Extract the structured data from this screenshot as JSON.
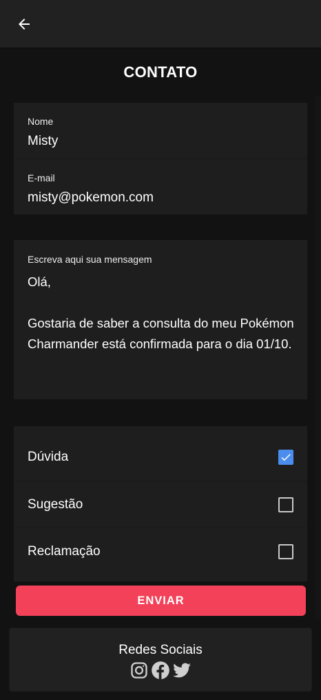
{
  "header": {
    "back_icon": "arrow-left-icon"
  },
  "page": {
    "title": "CONTATO"
  },
  "contact": {
    "name_label": "Nome",
    "name_value": "Misty",
    "email_label": "E-mail",
    "email_value": "misty@pokemon.com"
  },
  "message": {
    "label": "Escreva aqui sua mensagem",
    "value": "Olá,\n\nGostaria de saber a consulta do meu Pokémon Charmander está confirmada para o dia 01/10."
  },
  "options": [
    {
      "label": "Dúvida",
      "checked": true
    },
    {
      "label": "Sugestão",
      "checked": false
    },
    {
      "label": "Reclamação",
      "checked": false
    }
  ],
  "actions": {
    "send_label": "ENVIAR"
  },
  "footer": {
    "title": "Redes Sociais",
    "icons": [
      "instagram-icon",
      "facebook-icon",
      "twitter-icon"
    ]
  },
  "colors": {
    "accent_button": "#f24158",
    "checkbox_checked": "#4b8dec",
    "background": "#121212",
    "card": "#1e1e1e"
  }
}
